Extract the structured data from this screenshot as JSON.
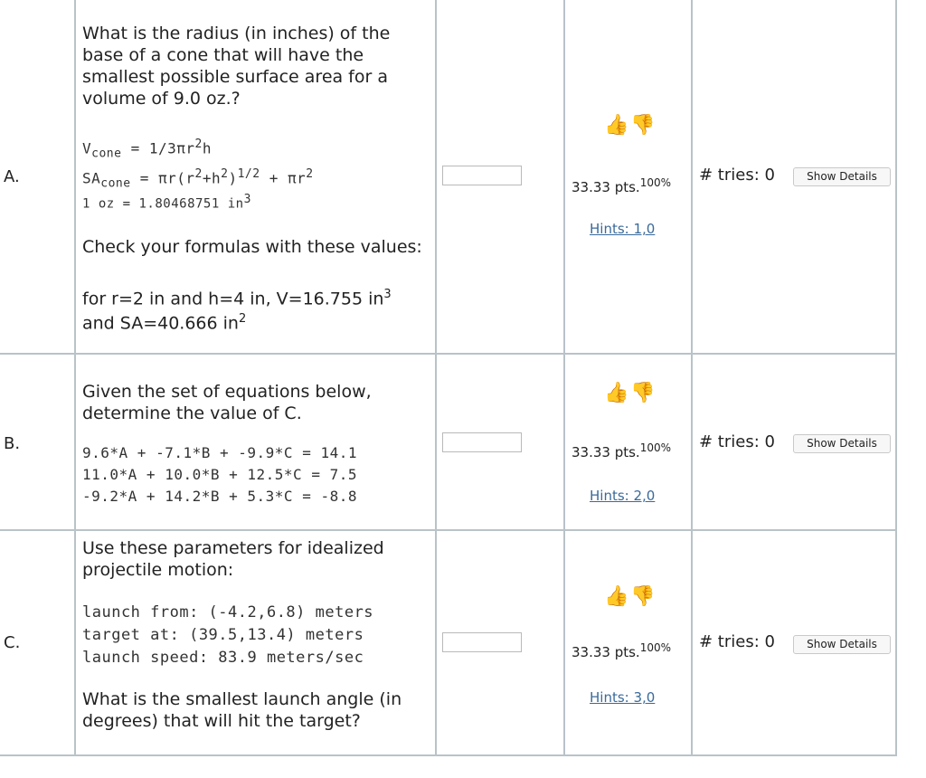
{
  "rows": [
    {
      "letter": "A.",
      "question_lines": [
        "What is the radius (in inches) of the base of a cone that will have the smallest possible surface area for a volume of 9.0 oz.?"
      ],
      "formula": {
        "v_label": "V",
        "v_sub": "cone",
        "v_expr": " = 1/3πr",
        "v_sup": "2",
        "v_tail": "h",
        "sa_label": "SA",
        "sa_sub": "cone",
        "sa_expr": " = πr(r",
        "sa_sup1": "2",
        "sa_mid": "+h",
        "sa_sup2": "2",
        "sa_close": ")",
        "sa_sup3": "1/2",
        "sa_tail": " + πr",
        "sa_sup4": "2",
        "oz_expr": "1 oz = 1.80468751 in",
        "oz_sup": "3"
      },
      "check_text": "Check your formulas with these values:",
      "check_line1": "for r=2 in and h=4 in, V=16.755 in",
      "check_line1_sup": "3",
      "check_line2": "and SA=40.666 in",
      "check_line2_sup": "2",
      "pts": "33.33 pts.",
      "pct": "100%",
      "hints": "Hints: 1,0",
      "tries": "# tries: 0",
      "button": "Show Details"
    },
    {
      "letter": "B.",
      "question_text": "Given the set of equations below, determine the value of C.",
      "equations": [
        "9.6*A + -7.1*B + -9.9*C = 14.1",
        "11.0*A + 10.0*B + 12.5*C = 7.5",
        "-9.2*A + 14.2*B + 5.3*C = -8.8"
      ],
      "pts": "33.33 pts.",
      "pct": "100%",
      "hints": "Hints: 2,0",
      "tries": "# tries: 0",
      "button": "Show Details"
    },
    {
      "letter": "C.",
      "question_text": "Use these parameters for idealized projectile motion:",
      "params": [
        "launch from: (-4.2,6.8) meters",
        "target at: (39.5,13.4) meters",
        "launch speed: 83.9 meters/sec"
      ],
      "final_text": "What is the smallest launch angle (in degrees) that will hit the target?",
      "pts": "33.33 pts.",
      "pct": "100%",
      "hints": "Hints: 3,0",
      "tries": "# tries: 0",
      "button": "Show Details"
    }
  ],
  "icons": {
    "thumbs_up": "thumbs-up-icon",
    "thumbs_down": "thumbs-down-icon"
  },
  "colors": {
    "grid": "#b9c3c8",
    "link": "#3a6a9a",
    "thumb_up": "#4a9a3a",
    "thumb_down": "#d23b3b"
  }
}
